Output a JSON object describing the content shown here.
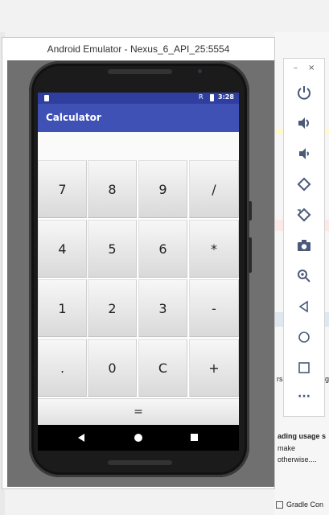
{
  "window": {
    "title": "Android Emulator - Nexus_6_API_25:5554"
  },
  "status_bar": {
    "signal": "R",
    "time": "3:28"
  },
  "app": {
    "title": "Calculator"
  },
  "keypad": {
    "rows": [
      [
        "7",
        "8",
        "9",
        "/"
      ],
      [
        "4",
        "5",
        "6",
        "*"
      ],
      [
        "1",
        "2",
        "3",
        "-"
      ],
      [
        ".",
        "0",
        "C",
        "+"
      ]
    ],
    "equals": "="
  },
  "toolbar": {
    "minimize": "–",
    "close": "×",
    "icons": [
      "power-icon",
      "volume-up-icon",
      "volume-down-icon",
      "rotate-left-icon",
      "rotate-right-icon",
      "camera-icon",
      "zoom-icon",
      "back-icon",
      "home-icon",
      "overview-icon",
      "more-icon"
    ],
    "more_label": "···"
  },
  "ide": {
    "snippet_1": "ading usage s",
    "snippet_2": "make",
    "snippet_3": "otherwise....",
    "snippet_r": "rs",
    "snippet_g": "g",
    "gradle_console": "Gradle Con"
  },
  "colors": {
    "primary": "#3f51b5",
    "primary_dark": "#303f9f",
    "screen_bg": "#ffffff"
  }
}
